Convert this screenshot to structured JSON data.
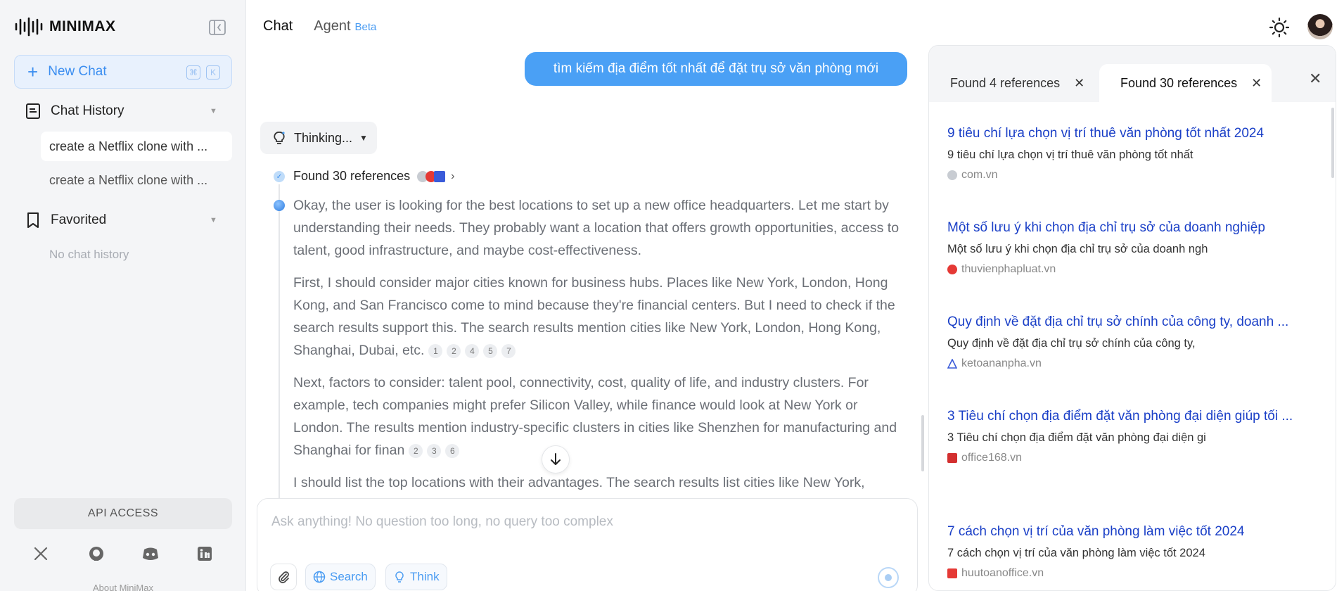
{
  "brand": {
    "name": "MINIMAX"
  },
  "sidebar": {
    "new_chat_label": "New Chat",
    "shortcut_keys": [
      "⌘",
      "K"
    ],
    "history_title": "Chat History",
    "history_items": [
      {
        "label": "create a Netflix clone with ..."
      },
      {
        "label": "create a Netflix clone with ..."
      }
    ],
    "favorited_title": "Favorited",
    "favorited_empty": "No chat history",
    "api_access_label": "API ACCESS",
    "social_icons": [
      "x-icon",
      "github-icon",
      "discord-icon",
      "linkedin-icon"
    ],
    "about_label": "About MiniMax"
  },
  "header": {
    "tab_chat": "Chat",
    "tab_agent": "Agent",
    "agent_badge": "Beta"
  },
  "chat": {
    "user_message": "tìm kiếm địa điểm tốt nhất để đặt trụ sở văn phòng mới",
    "thinking_label": "Thinking...",
    "references_label": "Found 30 references",
    "paragraphs": [
      {
        "text": "Okay, the user is looking for the best locations to set up a new office headquarters. Let me start by understanding their needs. They probably want a location that offers growth opportunities, access to talent, good infrastructure, and maybe cost-effectiveness.",
        "citations": []
      },
      {
        "text": "First, I should consider major cities known for business hubs. Places like New York, London, Hong Kong, and San Francisco come to mind because they're financial centers. But I need to check if the search results support this. The search results mention cities like New York, London, Hong Kong, Shanghai, Dubai, etc.",
        "citations": [
          "1",
          "2",
          "4",
          "5",
          "7"
        ]
      },
      {
        "text": "Next, factors to consider: talent pool, connectivity, cost, quality of life, and industry clusters. For example, tech companies might prefer Silicon Valley, while finance would look at New York or London. The results mention industry-specific clusters in cities like Shenzhen for manufacturing and Shanghai for finan",
        "citations": [
          "2",
          "3",
          "6"
        ]
      },
      {
        "text": "I should list the top locations with their advantages. The search results list cities like New York,",
        "citations": []
      }
    ],
    "input_placeholder": "Ask anything! No question too long, no query too complex",
    "search_label": "Search",
    "think_label": "Think"
  },
  "references_panel": {
    "tabs": [
      {
        "label": "Found 4 references",
        "active": false
      },
      {
        "label": "Found 30 references",
        "active": true
      }
    ],
    "items": [
      {
        "title": "9 tiêu chí lựa chọn vị trí thuê văn phòng tốt nhất 2024",
        "snippet": "9 tiêu chí lựa chọn vị trí thuê văn phòng tốt nhất",
        "source": "com.vn",
        "icon_color": "#c8ccd2"
      },
      {
        "title": "Một số lưu ý khi chọn địa chỉ trụ sở của doanh nghiệp",
        "snippet": "Một số lưu ý khi chọn địa chỉ trụ sở của doanh ngh",
        "source": "thuvienphapluat.vn",
        "icon_color": "#e53935"
      },
      {
        "title": "Quy định về đặt địa chỉ trụ sở chính của công ty, doanh ...",
        "snippet": "Quy định về đặt địa chỉ trụ sở chính của công ty,",
        "source": "ketoananpha.vn",
        "icon_color": "#3a5bd9"
      },
      {
        "title": "3 Tiêu chí chọn địa điểm đặt văn phòng đại diện giúp tối ...",
        "snippet": "3 Tiêu chí chọn địa điểm đặt văn phòng đại diện gi",
        "source": "office168.vn",
        "icon_color": "#d32f2f"
      },
      {
        "title": "7 cách chọn vị trí của văn phòng làm việc tốt 2024",
        "snippet": "7 cách chọn vị trí của văn phòng làm việc tốt 2024",
        "source": "huutoanoffice.vn",
        "icon_color": "#e53935"
      }
    ]
  },
  "colors": {
    "accent": "#4aa0f5",
    "link": "#1a3fc7",
    "sidebar_bg": "#f4f5f7"
  }
}
